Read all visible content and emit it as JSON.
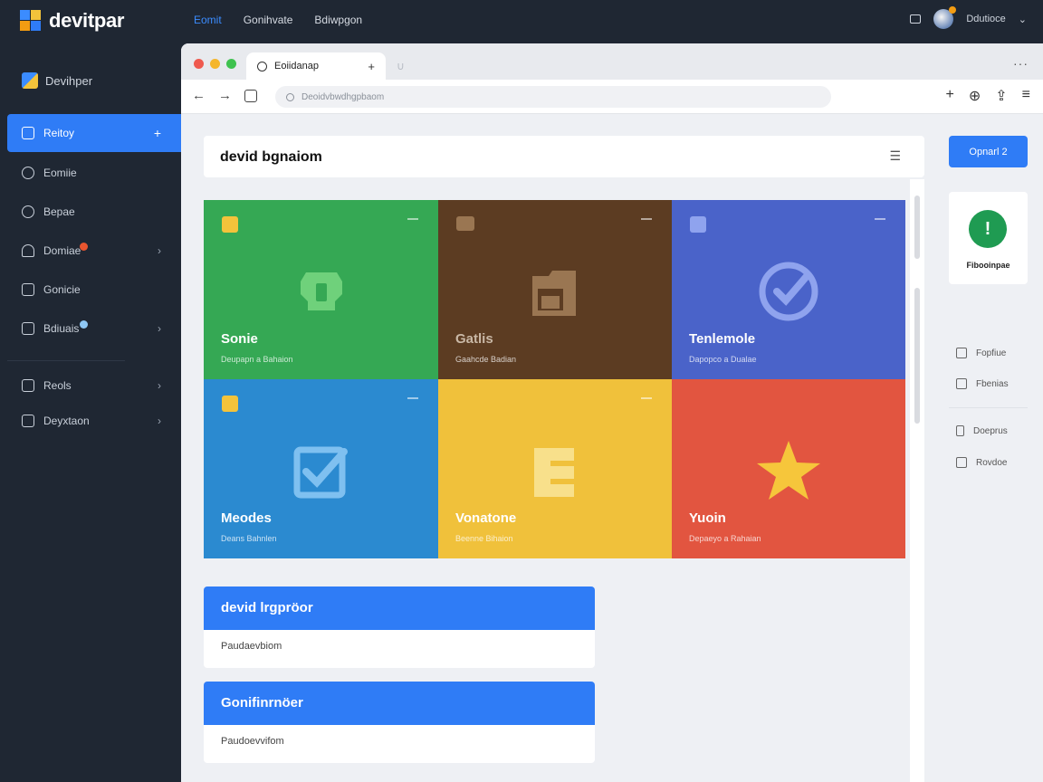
{
  "app": {
    "name": "devitpar"
  },
  "topnav": {
    "items": [
      "Eomit",
      "Gonihvate",
      "Bdiwpgon"
    ],
    "active_index": 0
  },
  "topright": {
    "user_label": "Ddutioce"
  },
  "sidebar": {
    "brand": "Devihper",
    "items": [
      {
        "label": "Reitoy",
        "icon": "clipboard-icon"
      },
      {
        "label": "Eomiie",
        "icon": "edit-icon"
      },
      {
        "label": "Bepae",
        "icon": "link-icon"
      },
      {
        "label": "Domiae",
        "icon": "user-icon"
      },
      {
        "label": "Gonicie",
        "icon": "image-icon"
      },
      {
        "label": "Bdiuais",
        "icon": "export-icon"
      },
      {
        "label": "Reols",
        "icon": "inbox-icon"
      },
      {
        "label": "Deyxtaon",
        "icon": "chat-icon"
      }
    ]
  },
  "browser": {
    "tab_title": "Eoiidanap",
    "url": "Deoidvbwdhgpbaom"
  },
  "content": {
    "title": "devid bgnaiom",
    "tiles": [
      {
        "name": "Sonie",
        "sub": "Deupapn a Bahaion",
        "color": "#35a854",
        "glyph": "shield-icon",
        "badge": "#f3c33b"
      },
      {
        "name": "Gatlis",
        "sub": "Gaahcde Badian",
        "color": "#5c3c22",
        "glyph": "folder-icon",
        "badge": "#9a7652"
      },
      {
        "name": "Tenlemole",
        "sub": "Dapopco a Dualae",
        "color": "#4a63c9",
        "glyph": "check-circle-icon",
        "badge": "#8fa3ee"
      },
      {
        "name": "Meodes",
        "sub": "Deans Bahnlen",
        "color": "#2b8ad0",
        "glyph": "checkbox-icon",
        "badge": "#f3c33b"
      },
      {
        "name": "Vonatone",
        "sub": "Beenne Bihaion",
        "color": "#f0c13b",
        "glyph": "document-icon",
        "badge": "#f0c13b"
      },
      {
        "name": "Yuoin",
        "sub": "Depaeyo a Rahaian",
        "color": "#e25540",
        "glyph": "star-icon",
        "badge": "#e25540"
      }
    ],
    "cards": [
      {
        "head": "devid lrgpröor",
        "body": "Paudaevbiom"
      },
      {
        "head": "Gonifinrnöer",
        "body": "Paudoevvifom"
      }
    ]
  },
  "right_panel": {
    "open_button": "Opnarl 2",
    "status_label": "Fibooinpae",
    "links": [
      "Fopfiue",
      "Fbenias",
      "Doeprus",
      "Rovdoe"
    ]
  }
}
